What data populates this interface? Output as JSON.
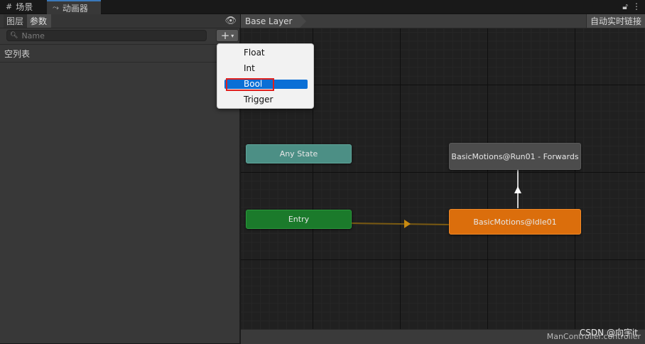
{
  "tabs": {
    "scene": {
      "label": "场景",
      "icon": "grid-icon"
    },
    "animator": {
      "label": "动画器",
      "icon": "animator-icon"
    },
    "controls": {
      "lock": "lock-icon",
      "menu": "kebab-icon"
    }
  },
  "left_panel": {
    "tabs": {
      "layers": "图层",
      "parameters": "参数"
    },
    "search": {
      "placeholder": "Name",
      "value": ""
    },
    "add_button": {
      "label": "+",
      "caret": "▾"
    },
    "empty_list": "空列表"
  },
  "graph": {
    "breadcrumb": "Base Layer",
    "auto_live_link": "自动实时链接",
    "nodes": {
      "any_state": "Any State",
      "entry": "Entry",
      "run": "BasicMotions@Run01 - Forwards",
      "idle": "BasicMotions@Idle01"
    },
    "filename": "ManController.controller"
  },
  "menu": {
    "items": [
      "Float",
      "Int",
      "Bool",
      "Trigger"
    ],
    "selected": "Bool"
  },
  "watermark": "CSDN @向宇it",
  "colors": {
    "any_state": "#4c8f85",
    "entry": "#1b7a2b",
    "idle": "#db6e0c",
    "run": "#4c4c4c",
    "menu_highlight": "#0a6fd6",
    "annotation_box": "#e0201e"
  }
}
